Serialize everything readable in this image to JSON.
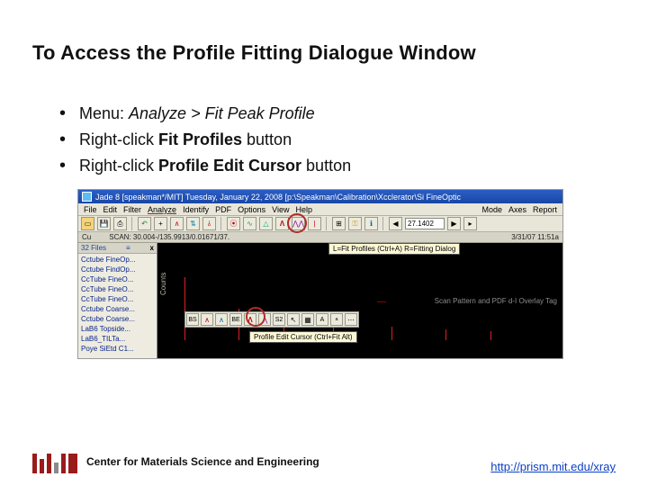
{
  "title": "To Access the Profile Fitting Dialogue Window",
  "bullets": [
    {
      "pre": "Menu: ",
      "em": "Analyze > Fit Peak Profile",
      "post": ""
    },
    {
      "pre": "Right-click ",
      "em": "Fit Profiles",
      "post": " button"
    },
    {
      "pre": "Right-click ",
      "em": "Profile Edit Cursor",
      "post": " button"
    }
  ],
  "app": {
    "titlebar": "Jade 8 [speakman*/MIT] Tuesday, January 22, 2008 [p:\\Speakman\\Calibration\\Xcclerator\\Si FineOptic",
    "menus": [
      "File",
      "Edit",
      "Filter",
      "Analyze",
      "Identify",
      "PDF",
      "Options",
      "View",
      "Help",
      "Mode",
      "Axes",
      "Report"
    ],
    "toolbar_value": "27.1402",
    "infobar_left": "Cu",
    "infobar_mid": "SCAN: 30.004-/135.9913/0.01671/37.",
    "infobar_right": "3/31/07 11:51a",
    "filehead": "32 Files",
    "files": [
      "Cctube FineOp...",
      "Cctube FindOp...",
      "CcTube FineO...",
      "CcTube FineO...",
      "CcTube FineO...",
      "Cctube Coarse...",
      "Cctube Coarse...",
      "LaB6 Topside...",
      "LaB6_TILTa...",
      "Poye SiEtd C1..."
    ],
    "ylabel": "Counts",
    "tooltip1": "L=Fit Profiles (Ctrl+A)   R=Fitting Dialog",
    "tooltip2": "Profile Edit Cursor (Ctrl+Fit Alt)",
    "overlay": "Scan Pattern and PDF d-I Overlay Tag"
  },
  "footer": {
    "center": "Center for Materials Science and Engineering",
    "link": "http://prism.mit.edu/xray"
  }
}
